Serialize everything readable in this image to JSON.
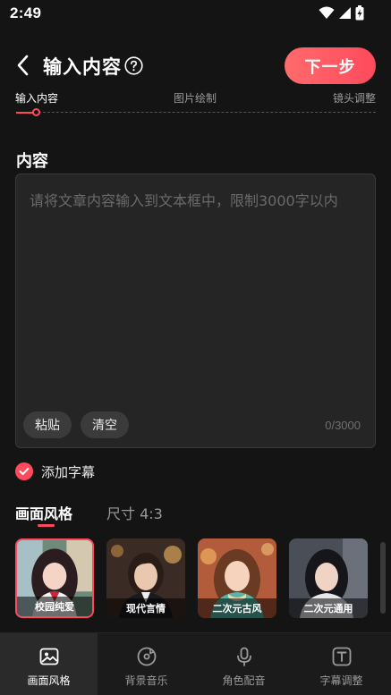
{
  "status_bar": {
    "time": "2:49"
  },
  "header": {
    "title": "输入内容",
    "next_label": "下一步"
  },
  "steps": [
    {
      "label": "输入内容",
      "active": true
    },
    {
      "label": "图片绘制",
      "active": false
    },
    {
      "label": "镜头调整",
      "active": false
    }
  ],
  "content": {
    "title": "内容",
    "value": "",
    "placeholder": "请将文章内容输入到文本框中，限制3000字以内",
    "paste_label": "粘贴",
    "clear_label": "清空",
    "char_count": "0/3000"
  },
  "subtitle": {
    "label": "添加字幕",
    "checked": true
  },
  "style_tabs": {
    "style_label": "画面风格",
    "size_label": "尺寸 4:3"
  },
  "styles": [
    {
      "label": "校园纯爱",
      "selected": true
    },
    {
      "label": "现代言情",
      "selected": false
    },
    {
      "label": "二次元古风",
      "selected": false
    },
    {
      "label": "二次元通用",
      "selected": false
    }
  ],
  "bottom_nav": [
    {
      "label": "画面风格",
      "icon": "image-icon",
      "active": true
    },
    {
      "label": "背景音乐",
      "icon": "music-disc-icon",
      "active": false
    },
    {
      "label": "角色配音",
      "icon": "microphone-icon",
      "active": false
    },
    {
      "label": "字幕调整",
      "icon": "text-box-icon",
      "active": false
    }
  ],
  "colors": {
    "accent": "#ff4a5d",
    "background": "#141414",
    "panel": "#252525"
  }
}
